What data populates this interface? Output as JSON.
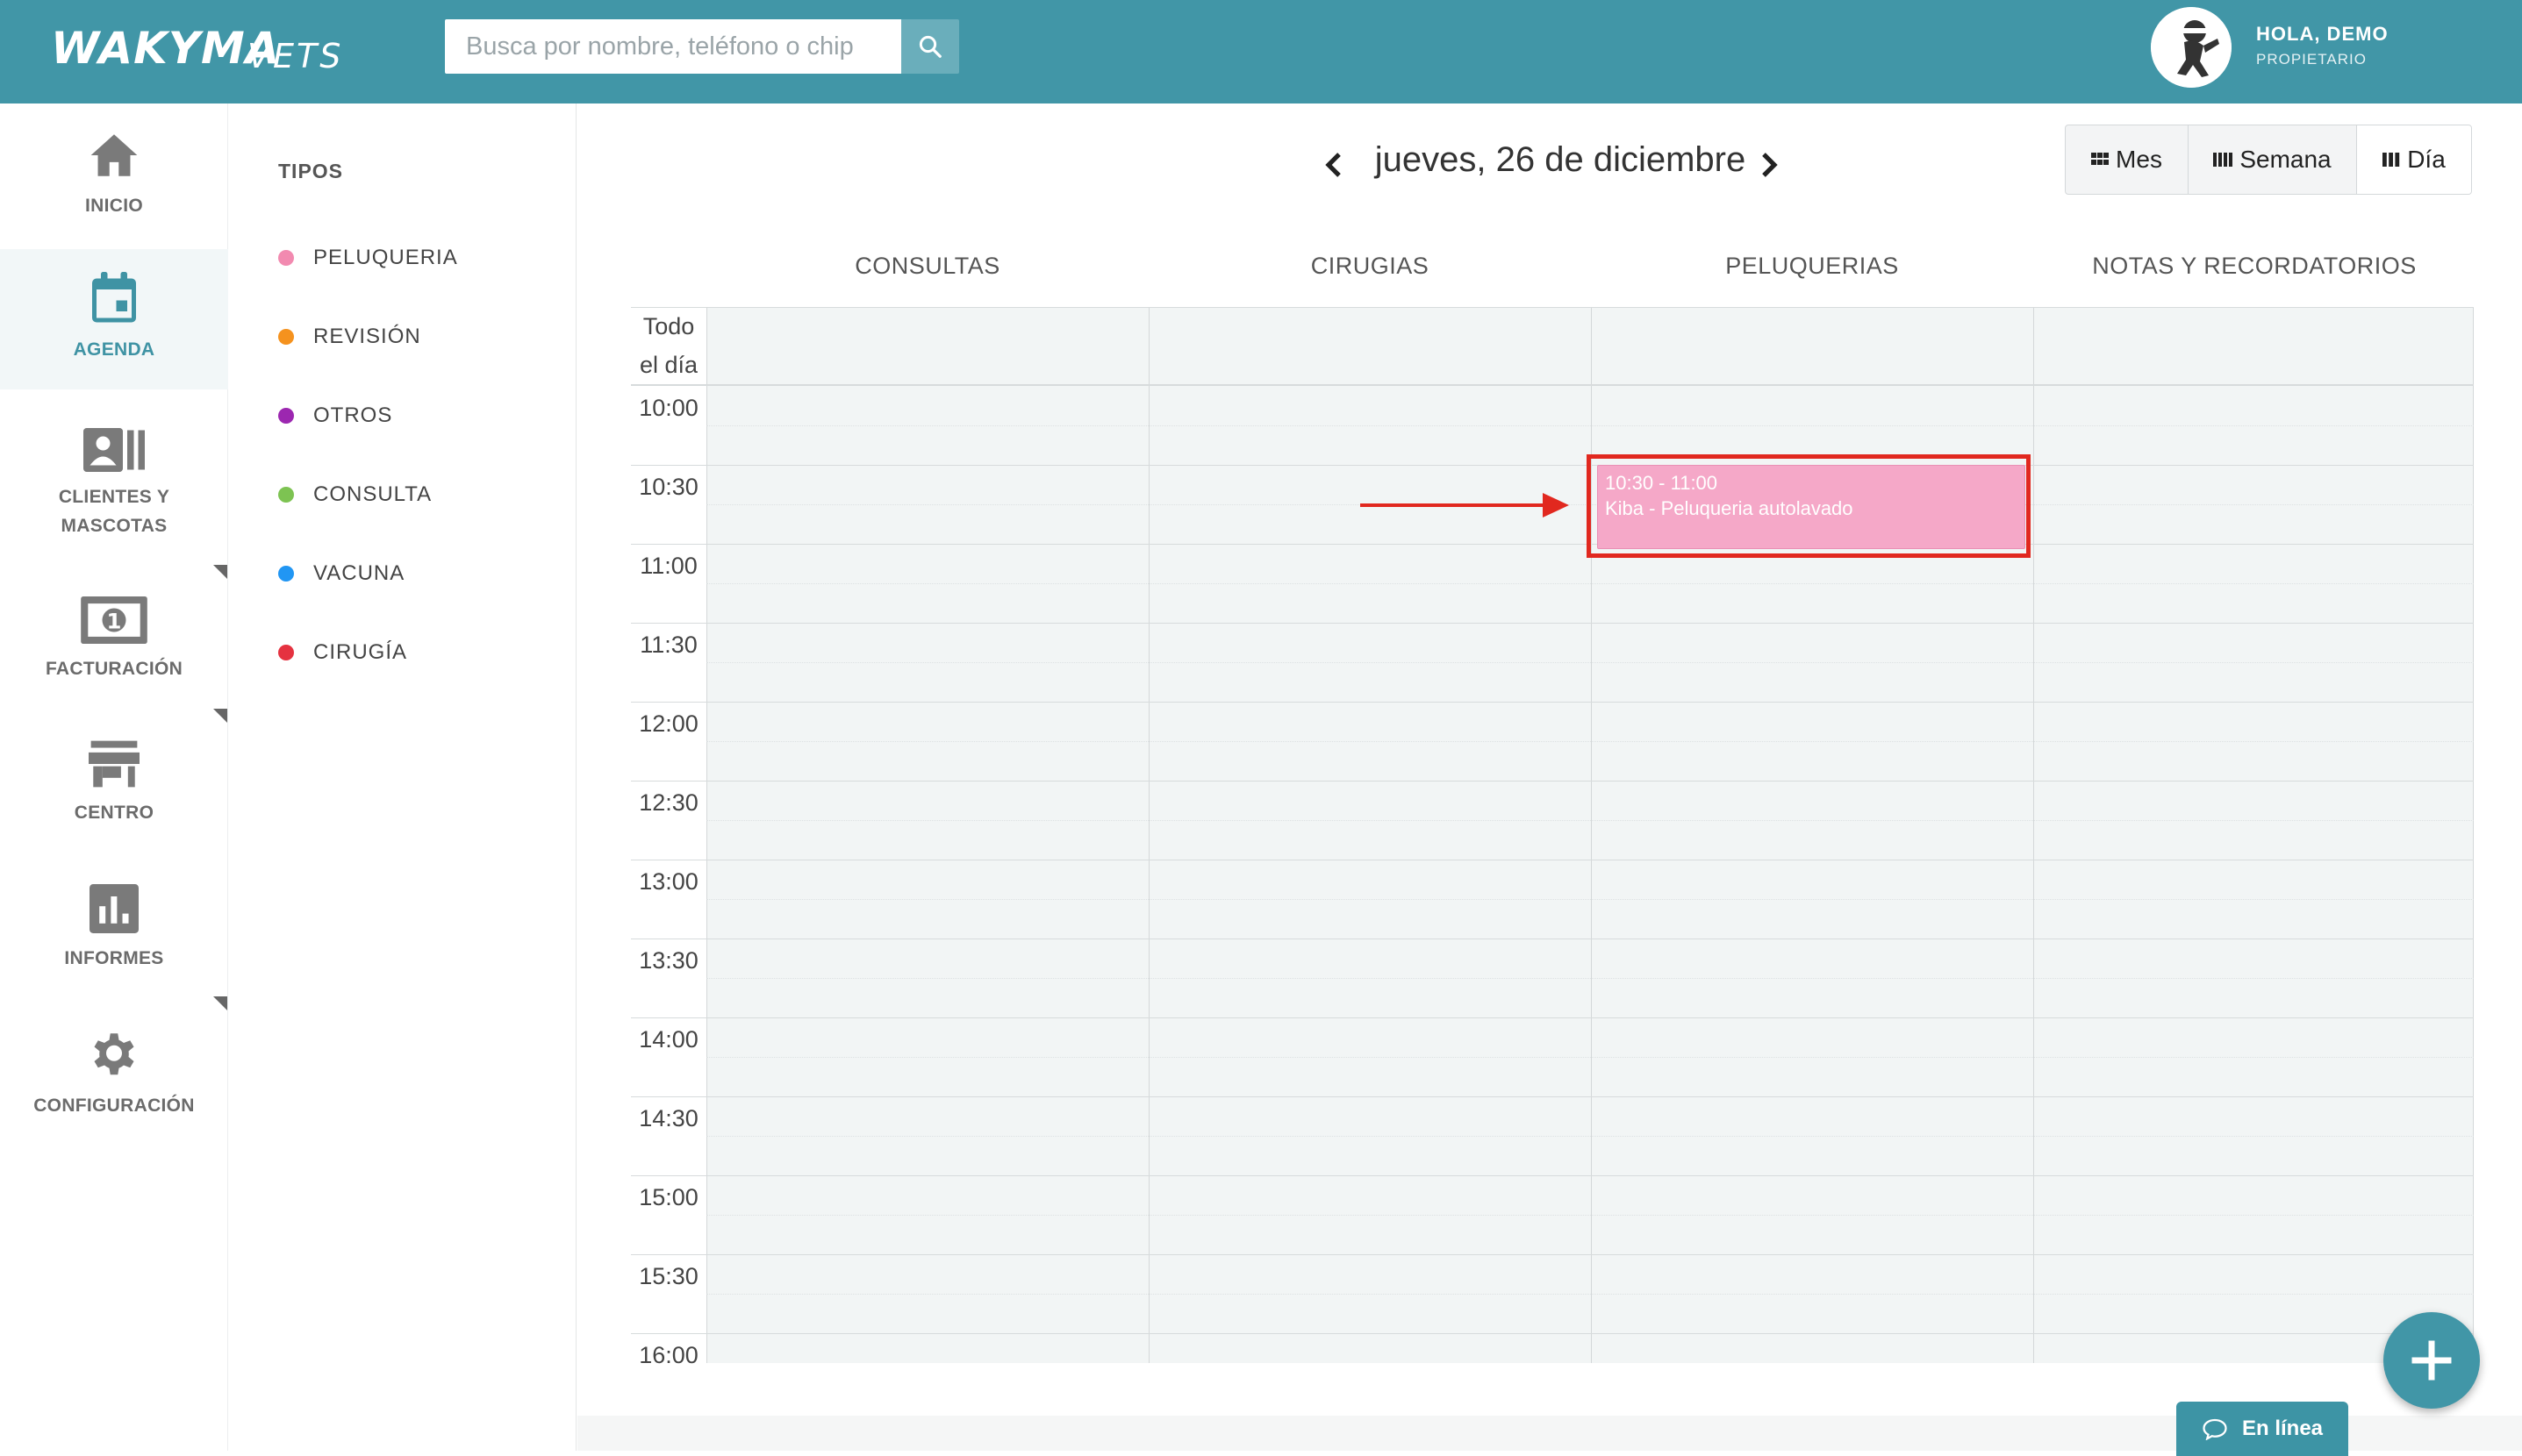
{
  "header": {
    "logo_main": "WAKYMA",
    "logo_sub": "VETS",
    "search_placeholder": "Busca por nombre, teléfono o chip",
    "search_icon": "search-icon",
    "greeting": "HOLA, DEMO",
    "role": "PROPIETARIO",
    "brand_color": "#4196a7"
  },
  "sidebar": {
    "items": [
      {
        "label": "INICIO",
        "icon": "home-icon"
      },
      {
        "label": "AGENDA",
        "icon": "calendar-icon",
        "active": true
      },
      {
        "label_line1": "CLIENTES Y",
        "label_line2": "MASCOTAS",
        "icon": "contacts-icon"
      },
      {
        "label": "FACTURACIÓN",
        "icon": "money-icon"
      },
      {
        "label": "CENTRO",
        "icon": "store-icon"
      },
      {
        "label": "INFORMES",
        "icon": "chart-icon"
      },
      {
        "label": "CONFIGURACIÓN",
        "icon": "gear-icon"
      }
    ]
  },
  "types": {
    "title": "TIPOS",
    "items": [
      {
        "label": "PELUQUERIA",
        "color": "#f28ab0"
      },
      {
        "label": "REVISIÓN",
        "color": "#f5921e"
      },
      {
        "label": "OTROS",
        "color": "#9c27b0"
      },
      {
        "label": "CONSULTA",
        "color": "#7dc352"
      },
      {
        "label": "VACUNA",
        "color": "#2196f3"
      },
      {
        "label": "CIRUGÍA",
        "color": "#e53240"
      }
    ]
  },
  "calendar": {
    "date_title": "jueves, 26 de diciembre",
    "views": [
      {
        "label": "Mes",
        "icon": "month-grid-icon"
      },
      {
        "label": "Semana",
        "icon": "week-columns-icon"
      },
      {
        "label": "Día",
        "icon": "day-columns-icon",
        "selected": true
      }
    ],
    "columns": [
      "CONSULTAS",
      "CIRUGIAS",
      "PELUQUERIAS",
      "NOTAS Y RECORDATORIOS"
    ],
    "allday_line1": "Todo",
    "allday_line2": "el día",
    "times": [
      "10:00",
      "10:30",
      "11:00",
      "11:30",
      "12:00",
      "12:30",
      "13:00",
      "13:30",
      "14:00",
      "14:30",
      "15:00",
      "15:30",
      "16:00"
    ],
    "event": {
      "time": "10:30 - 11:00",
      "title": "Kiba - Peluqueria autolavado",
      "column": "PELUQUERIAS",
      "color": "#f5a8c8"
    }
  },
  "chat": {
    "label": "En línea",
    "icon": "chat-bubble-icon"
  },
  "fab": {
    "icon": "plus-icon"
  }
}
